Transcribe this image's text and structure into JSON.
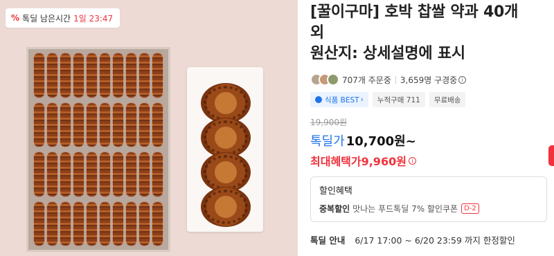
{
  "deal_badge": {
    "icon": "percent-icon",
    "label": "톡딜 남은시간",
    "time": "1일 23:47"
  },
  "product": {
    "title_line1": "[꿀이구마] 호박 찹쌀 약과 40개",
    "title_line2": "외",
    "title_line3": "원산지: 상세설명에 표시"
  },
  "stats": {
    "orders": "707개 주문중",
    "viewers": "3,659명 구경중"
  },
  "tags": {
    "best": "식품 BEST",
    "cumulative": "누적구매 711",
    "shipping": "무료배송"
  },
  "pricing": {
    "original": "19,900원",
    "sale_label": "톡딜가",
    "sale_price": "10,700원~",
    "max_benefit": "최대혜택가9,960원"
  },
  "discount": {
    "heading": "할인혜택",
    "row_key": "중복할인",
    "row_text": "맛나는 푸드톡딜 7% 할인쿠폰",
    "badge": "D-2"
  },
  "notice": {
    "label": "톡딜 안내",
    "period": "6/17 17:00 ~ 6/20 23:59 까지 한정할인"
  },
  "colors": {
    "accent_red": "#f0323c",
    "accent_blue": "#1f73e8"
  }
}
